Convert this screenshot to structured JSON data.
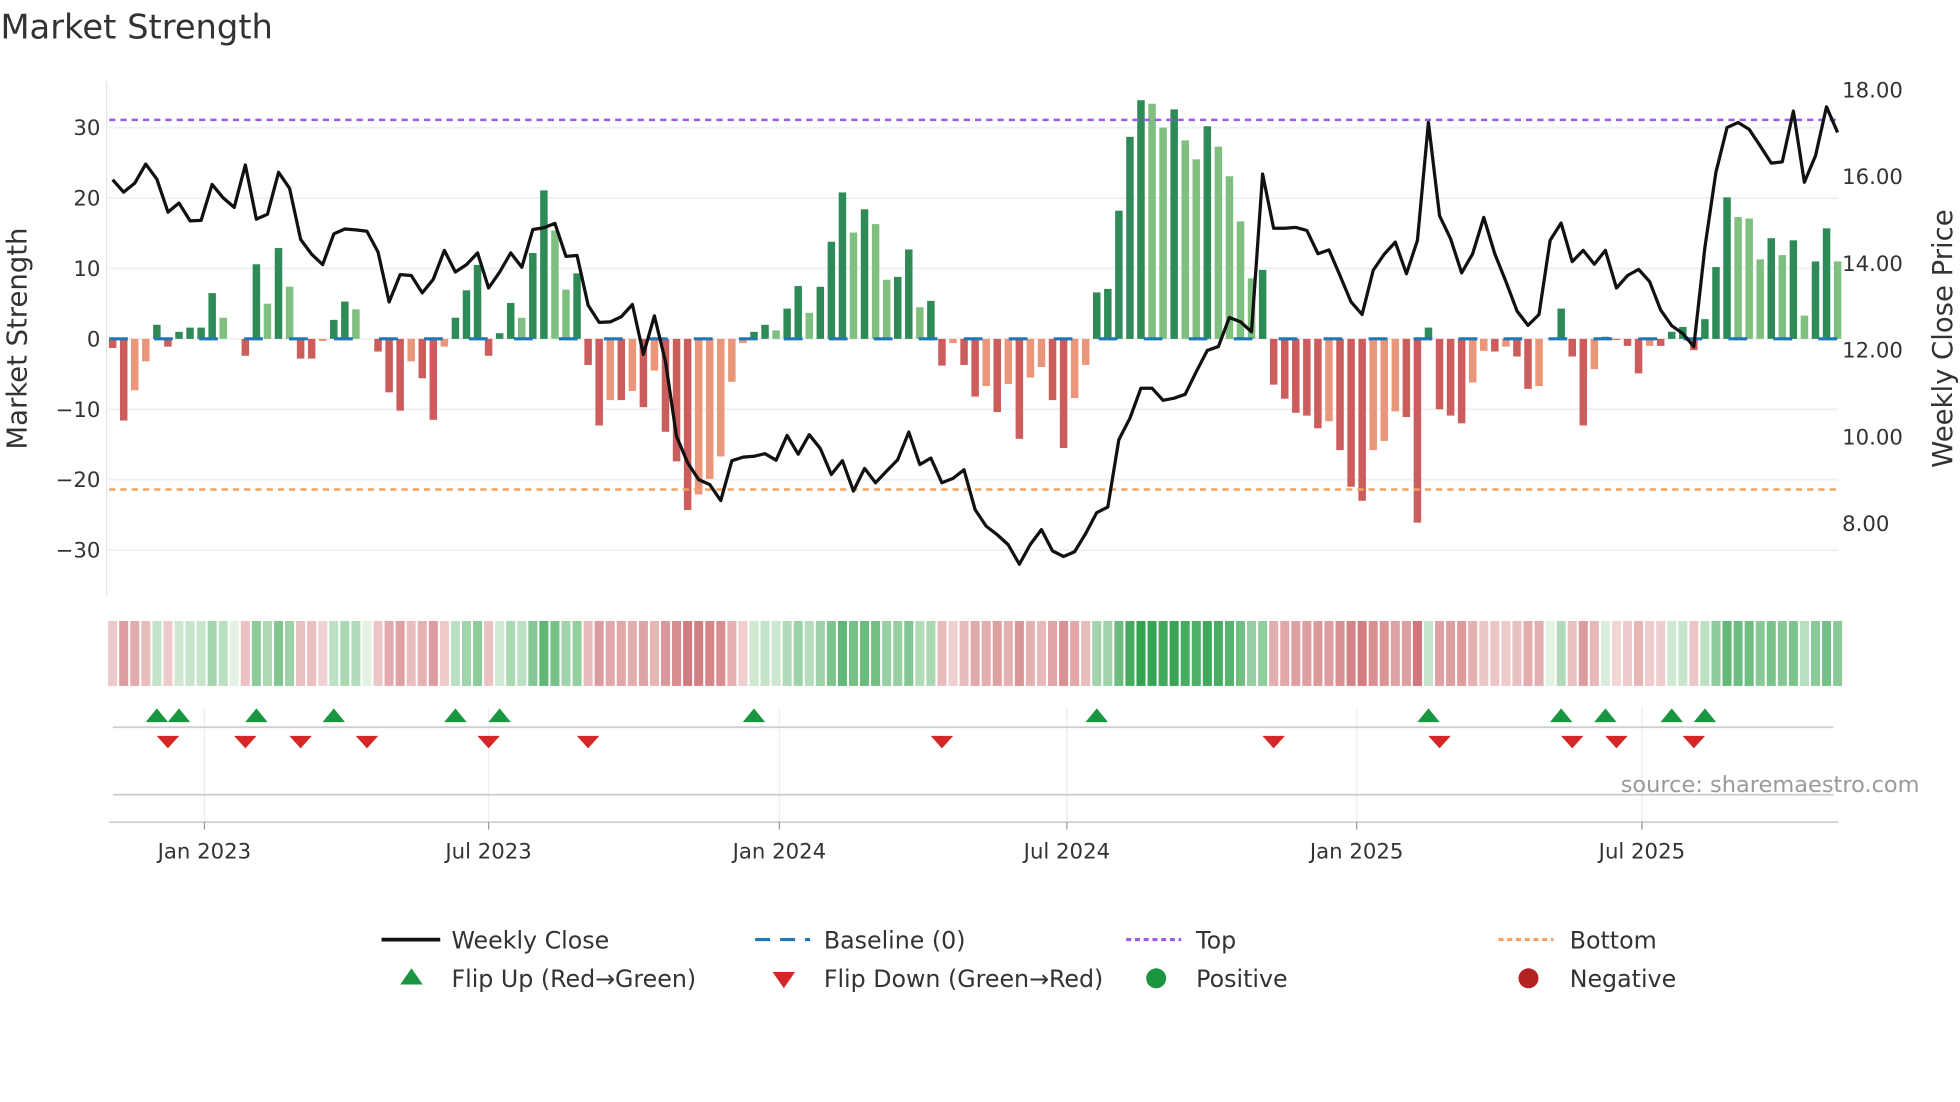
{
  "title": "Market Strength",
  "source": "source: sharemaestro.com",
  "chart_data": {
    "type": "bar+line",
    "title": "Market Strength",
    "ylabel_left": "Market Strength",
    "ylabel_right": "Weekly Close Price",
    "ylim_left": [
      -36.7,
      36.6
    ],
    "ylim_right": [
      6.3,
      18.2
    ],
    "yticks_left": [
      {
        "v": 30,
        "label": "30"
      },
      {
        "v": 20,
        "label": "20"
      },
      {
        "v": 10,
        "label": "10"
      },
      {
        "v": 0,
        "label": "0"
      },
      {
        "v": -10,
        "label": "−10"
      },
      {
        "v": -20,
        "label": "−20"
      },
      {
        "v": -30,
        "label": "−30"
      }
    ],
    "yticks_right": [
      {
        "v": 18,
        "label": "18.00"
      },
      {
        "v": 16,
        "label": "16.00"
      },
      {
        "v": 14,
        "label": "14.00"
      },
      {
        "v": 12,
        "label": "12.00"
      },
      {
        "v": 10,
        "label": "10.00"
      },
      {
        "v": 8,
        "label": "8.00"
      }
    ],
    "xticks": [
      {
        "week": 8.3,
        "label": "Jan 2023"
      },
      {
        "week": 34.0,
        "label": "Jul 2023"
      },
      {
        "week": 60.3,
        "label": "Jan 2024"
      },
      {
        "week": 86.3,
        "label": "Jul 2024"
      },
      {
        "week": 112.5,
        "label": "Jan 2025"
      },
      {
        "week": 138.3,
        "label": "Jul 2025"
      }
    ],
    "grid": true,
    "top_level": 31.1,
    "bottom_level": -21.4,
    "baseline": 0,
    "strength": [
      -1.3,
      -11.6,
      -7.3,
      -3.2,
      2.0,
      -1.1,
      1.0,
      1.6,
      1.6,
      6.5,
      3.0,
      0,
      -2.4,
      10.6,
      5.0,
      12.9,
      7.4,
      -2.8,
      -2.8,
      -0.3,
      2.7,
      5.3,
      4.2,
      0,
      -1.8,
      -7.6,
      -10.2,
      -3.2,
      -5.6,
      -11.5,
      -1.1,
      3.0,
      6.9,
      10.5,
      -2.4,
      0.8,
      5.1,
      3.0,
      12.2,
      21.1,
      15.4,
      7.0,
      9.3,
      -3.7,
      -12.3,
      -8.7,
      -8.7,
      -7.4,
      -9.7,
      -4.5,
      -13.2,
      -17.4,
      -24.3,
      -22.1,
      -19.9,
      -16.7,
      -6.1,
      -0.6,
      1.0,
      2.0,
      1.2,
      4.3,
      7.5,
      3.7,
      7.4,
      13.8,
      20.8,
      15.1,
      18.4,
      16.3,
      8.4,
      8.8,
      12.7,
      4.5,
      5.4,
      -3.8,
      -0.6,
      -3.7,
      -8.2,
      -6.7,
      -10.4,
      -6.4,
      -14.2,
      -5.5,
      -4.0,
      -8.7,
      -15.5,
      -8.4,
      -3.7,
      6.6,
      7.1,
      18.2,
      28.7,
      33.9,
      33.4,
      30.0,
      32.6,
      28.2,
      25.5,
      30.2,
      27.3,
      23.1,
      16.7,
      8.6,
      9.8,
      -6.5,
      -8.5,
      -10.5,
      -10.9,
      -12.7,
      -11.7,
      -15.8,
      -21.0,
      -23.0,
      -15.8,
      -14.5,
      -10.3,
      -11.1,
      -26.1,
      1.6,
      -10.0,
      -10.9,
      -12.0,
      -6.2,
      -1.7,
      -1.8,
      -1.1,
      -2.5,
      -7.1,
      -6.7,
      0,
      4.3,
      -2.5,
      -12.3,
      -4.3,
      0.3,
      -0.1,
      -1.0,
      -4.9,
      -1.0,
      -1.0,
      1.0,
      1.7,
      -1.6,
      2.8,
      10.2,
      20.1,
      17.3,
      17.1,
      11.3,
      14.3,
      11.9,
      14.0,
      3.3,
      11.0,
      15.7,
      11.0
    ],
    "close": [
      15.93,
      15.64,
      15.85,
      16.29,
      15.94,
      15.18,
      15.39,
      14.98,
      14.99,
      15.82,
      15.51,
      15.29,
      16.27,
      15.02,
      15.13,
      16.1,
      15.73,
      14.55,
      14.21,
      13.97,
      14.68,
      14.79,
      14.77,
      14.74,
      14.26,
      13.11,
      13.74,
      13.72,
      13.32,
      13.63,
      14.3,
      13.8,
      13.97,
      14.24,
      13.43,
      13.8,
      14.24,
      13.91,
      14.78,
      14.82,
      14.92,
      14.16,
      14.18,
      13.03,
      12.64,
      12.65,
      12.77,
      13.05,
      11.9,
      12.79,
      11.73,
      10.01,
      9.4,
      9.01,
      8.9,
      8.53,
      9.45,
      9.53,
      9.55,
      9.61,
      9.46,
      10.03,
      9.6,
      10.05,
      9.73,
      9.13,
      9.45,
      8.75,
      9.27,
      8.94,
      9.21,
      9.47,
      10.11,
      9.36,
      9.51,
      8.94,
      9.04,
      9.24,
      8.32,
      7.94,
      7.74,
      7.51,
      7.06,
      7.52,
      7.86,
      7.37,
      7.24,
      7.35,
      7.77,
      8.25,
      8.38,
      9.93,
      10.43,
      11.12,
      11.12,
      10.84,
      10.89,
      10.98,
      11.5,
      11.99,
      12.08,
      12.75,
      12.65,
      12.42,
      16.06,
      14.81,
      14.81,
      14.83,
      14.76,
      14.22,
      14.31,
      13.72,
      13.11,
      12.82,
      13.84,
      14.21,
      14.49,
      13.76,
      14.53,
      17.25,
      15.1,
      14.57,
      13.78,
      14.22,
      15.06,
      14.22,
      13.58,
      12.9,
      12.57,
      12.82,
      14.53,
      14.93,
      14.04,
      14.3,
      13.98,
      14.3,
      13.43,
      13.72,
      13.86,
      13.58,
      12.92,
      12.56,
      12.38,
      12.08,
      14.37,
      16.1,
      17.13,
      17.25,
      17.09,
      16.71,
      16.31,
      16.34,
      17.51,
      15.87,
      16.48,
      17.61,
      17.02
    ],
    "flip_up_weeks": [
      4,
      6,
      13,
      20,
      31,
      35,
      58,
      89,
      119,
      131,
      135,
      141,
      144
    ],
    "flip_down_weeks": [
      5,
      12,
      17,
      23,
      34,
      43,
      75,
      105,
      120,
      132,
      136,
      143
    ],
    "colors": {
      "pos_rising": "#2e8b57",
      "pos_falling": "#7fbf7f",
      "neg_falling": "#cd5c5c",
      "neg_rising": "#e9967a",
      "line": "#111111",
      "baseline": "#1f77b4",
      "top": "#9b5de5",
      "bottom": "#f4a261",
      "flip_up": "#1a9641",
      "flip_down": "#d62728",
      "positive": "#1a9641",
      "negative": "#b22222"
    },
    "legend": [
      {
        "key": "weekly_close",
        "label": "Weekly Close"
      },
      {
        "key": "baseline",
        "label": "Baseline (0)"
      },
      {
        "key": "top",
        "label": "Top"
      },
      {
        "key": "bottom",
        "label": "Bottom"
      },
      {
        "key": "flip_up",
        "label": "Flip Up (Red→Green)"
      },
      {
        "key": "flip_down",
        "label": "Flip Down (Green→Red)"
      },
      {
        "key": "positive",
        "label": "Positive"
      },
      {
        "key": "negative",
        "label": "Negative"
      }
    ],
    "legend_position": "bottom"
  }
}
